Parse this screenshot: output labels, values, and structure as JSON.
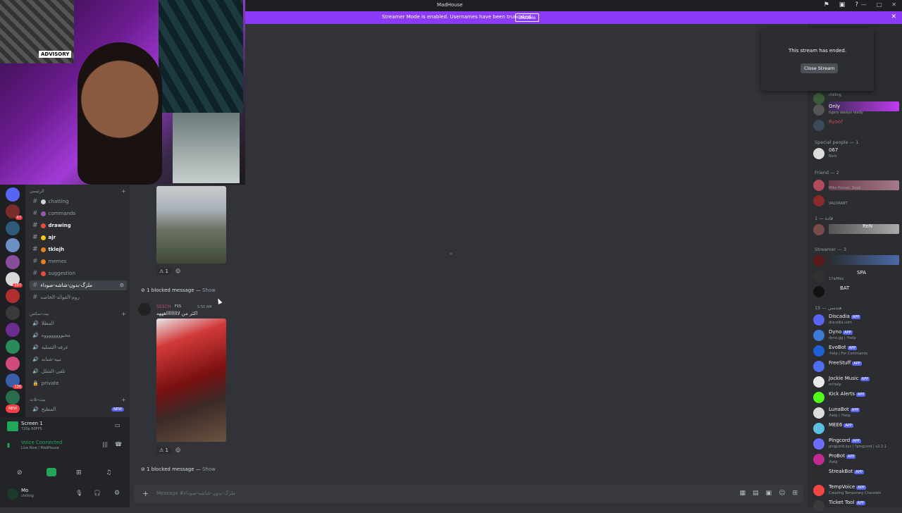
{
  "titlebar": {
    "title": "MadHouse"
  },
  "banner": {
    "text": "Streamer Mode is enabled. Usernames have been truncated.",
    "button": "Disable"
  },
  "webcam": {
    "sign": "ADVISORY"
  },
  "stream_popup": {
    "message": "This stream has ended.",
    "button": "Close Stream"
  },
  "channels": {
    "category1": "الرئيسي",
    "items": [
      {
        "name": "chatting",
        "state": "normal"
      },
      {
        "name": "commands",
        "state": "normal"
      },
      {
        "name": "drawing",
        "state": "unread"
      },
      {
        "name": "ajr",
        "state": "unread"
      },
      {
        "name": "tklejh",
        "state": "unread"
      },
      {
        "name": "memes",
        "state": "normal"
      },
      {
        "name": "suggestion",
        "state": "normal"
      },
      {
        "name": "ملزگ-بدون-شاشه-صوداء",
        "state": "active"
      },
      {
        "name": "روم-الفوائد-الخاصه",
        "state": "normal"
      }
    ],
    "category2": "بيت-سكس",
    "voice": [
      {
        "name": "المطلا"
      },
      {
        "name": "مخبووووووووه"
      },
      {
        "name": "غرفه-التسلية"
      },
      {
        "name": "نبيه-شبابه"
      },
      {
        "name": "تلقى-الشلل"
      },
      {
        "name": "private"
      }
    ],
    "category3": "بيت-ثلاث",
    "voice2": [
      {
        "name": "المطبخ"
      }
    ],
    "new_badge": "NEW"
  },
  "screen_panel": {
    "title": "Screen 1",
    "subtitle": "720p 60FPS"
  },
  "voice_panel": {
    "status": "Voice Connected",
    "location": "Live Now / MadHouse"
  },
  "user_panel": {
    "name": "Mo",
    "status": "chilling"
  },
  "chat": {
    "reaction1": "1",
    "blocked1": "1 blocked message — ",
    "show": "Show",
    "msg_author": "SSSCH",
    "msg_tag": "F15",
    "msg_time": "5:50 AM",
    "msg_text": "اكثر من لاااااااااهههه",
    "reaction2": "1",
    "blocked2": "1 blocked message — "
  },
  "composer": {
    "placeholder": "Message #ملزگ-بدون-شاشه-صوداء"
  },
  "members": {
    "rows_top": [
      {
        "name": "",
        "status": "chilling"
      },
      {
        "name": "Only",
        "status": "tigers always ready"
      },
      {
        "name": "Ryoof",
        "status": ""
      }
    ],
    "group_special": "Special people — 1",
    "special": [
      {
        "name": "067",
        "status": "Nvm"
      }
    ],
    "group_friend": "Friend — 2",
    "friends": [
      {
        "name": "",
        "status": "Mike Posner, Seeb"
      },
      {
        "name": "",
        "status": "VALORANT"
      }
    ],
    "group_1": "1 — قادة",
    "g1": [
      {
        "name": "ReN",
        "status": ""
      }
    ],
    "group_streamer": "Streamer — 3",
    "streamers": [
      {
        "name": "",
        "status": ""
      },
      {
        "name": "SPA",
        "status": "17a/Mez"
      },
      {
        "name": "BAT",
        "status": ""
      }
    ],
    "group_bots": "15 — هندسي",
    "bots": [
      {
        "name": "Discadia",
        "status": "discadia.com",
        "color": "#5865f2"
      },
      {
        "name": "Dyno",
        "status": "dyno.gg | ?help",
        "color": "#3a7bd5"
      },
      {
        "name": "EvoBot",
        "status": "-help | For Commands",
        "color": "#1e60d6"
      },
      {
        "name": "FreeStuff",
        "status": "",
        "color": "#4e6ef2"
      },
      {
        "name": "Jockie Music",
        "status": "m!help",
        "color": "#e9e9e9"
      },
      {
        "name": "Kick Alerts",
        "status": "",
        "color": "#53fc18"
      },
      {
        "name": "LunaBot",
        "status": "/help | ?help",
        "color": "#dcdcdc"
      },
      {
        "name": "MEE6",
        "status": "",
        "color": "#5bc0de"
      },
      {
        "name": "Pingcord",
        "status": "pingcord.xyz | ?pingcord | v2.2.1",
        "color": "#6c6cff"
      },
      {
        "name": "ProBot",
        "status": "/help",
        "color": "#c12a8f"
      },
      {
        "name": "StreakBot",
        "status": "",
        "color": "#2d2d2d"
      },
      {
        "name": "TempVoice",
        "status": "Creating Temporary Channels",
        "color": "#f04747"
      },
      {
        "name": "Ticket Tool",
        "status": "",
        "color": "#3b3b3b"
      }
    ],
    "app_badge": "APP"
  }
}
